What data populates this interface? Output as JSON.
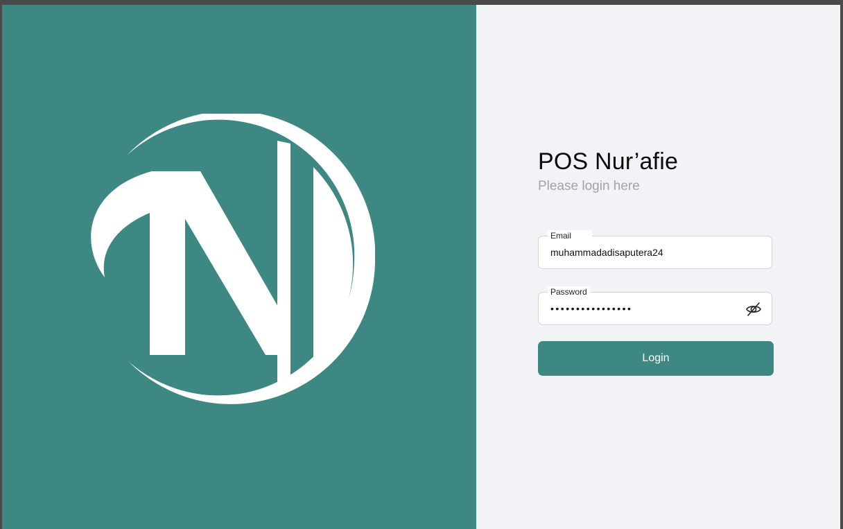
{
  "brand": {
    "panel_color": "#3e8883",
    "logo_icon": "n-monogram-logo-icon"
  },
  "login": {
    "title": "POS Nur’afie",
    "subtitle": "Please login here",
    "email": {
      "label": "Email",
      "value": "muhammadadisaputera24"
    },
    "password": {
      "label": "Password",
      "masked_value": "••••••••••••••••",
      "toggle_icon": "eye-slash-icon"
    },
    "button_label": "Login",
    "accent_color": "#3e8883"
  }
}
